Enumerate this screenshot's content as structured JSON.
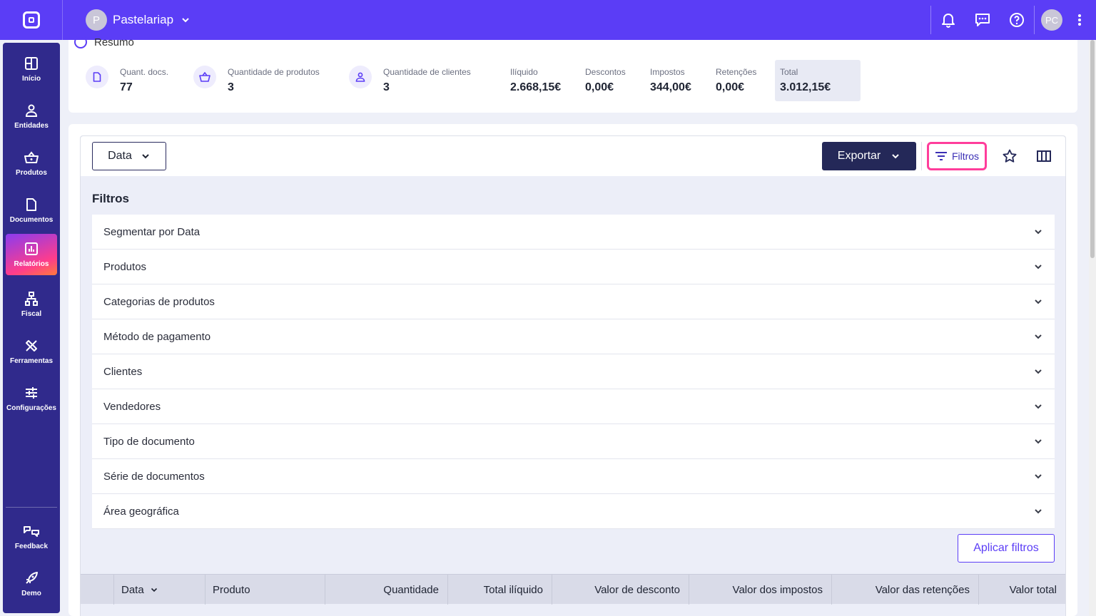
{
  "topbar": {
    "company_initial": "P",
    "company_name": "Pastelariap",
    "user_initials": "PC"
  },
  "sidebar": {
    "items": [
      {
        "label": "Início",
        "icon": "dashboard-icon"
      },
      {
        "label": "Entidades",
        "icon": "user-icon"
      },
      {
        "label": "Produtos",
        "icon": "basket-icon"
      },
      {
        "label": "Documentos",
        "icon": "document-icon"
      },
      {
        "label": "Relatórios",
        "icon": "chart-icon",
        "active": true
      },
      {
        "label": "Fiscal",
        "icon": "hierarchy-icon"
      },
      {
        "label": "Ferramentas",
        "icon": "tools-icon"
      },
      {
        "label": "Configurações",
        "icon": "sliders-icon"
      }
    ],
    "bottom_items": [
      {
        "label": "Feedback",
        "icon": "feedback-icon"
      },
      {
        "label": "Demo",
        "icon": "rocket-icon"
      }
    ]
  },
  "summary": {
    "title": "Resumo",
    "stats": [
      {
        "label": "Quant. docs.",
        "value": "77"
      },
      {
        "label": "Quantidade de produtos",
        "value": "3"
      },
      {
        "label": "Quantidade de clientes",
        "value": "3"
      },
      {
        "label": "Ilíquido",
        "value": "2.668,15€"
      },
      {
        "label": "Descontos",
        "value": "0,00€"
      },
      {
        "label": "Impostos",
        "value": "344,00€"
      },
      {
        "label": "Retenções",
        "value": "0,00€"
      },
      {
        "label": "Total",
        "value": "3.012,15€"
      }
    ]
  },
  "toolbar": {
    "date_button": "Data",
    "export_button": "Exportar",
    "filters_button": "Filtros"
  },
  "filters": {
    "title": "Filtros",
    "items": [
      "Segmentar por Data",
      "Produtos",
      "Categorias de produtos",
      "Método de pagamento",
      "Clientes",
      "Vendedores",
      "Tipo de documento",
      "Série de documentos",
      "Área geográfica"
    ],
    "apply_button": "Aplicar filtros"
  },
  "table": {
    "columns": [
      "Data",
      "Produto",
      "Quantidade",
      "Total ilíquido",
      "Valor de desconto",
      "Valor dos impostos",
      "Valor das retenções",
      "Valor total"
    ]
  },
  "colors": {
    "primary": "#5b3df6",
    "sidebar": "#302a8c",
    "export_button": "#242858",
    "highlight": "#ff3d9b"
  }
}
